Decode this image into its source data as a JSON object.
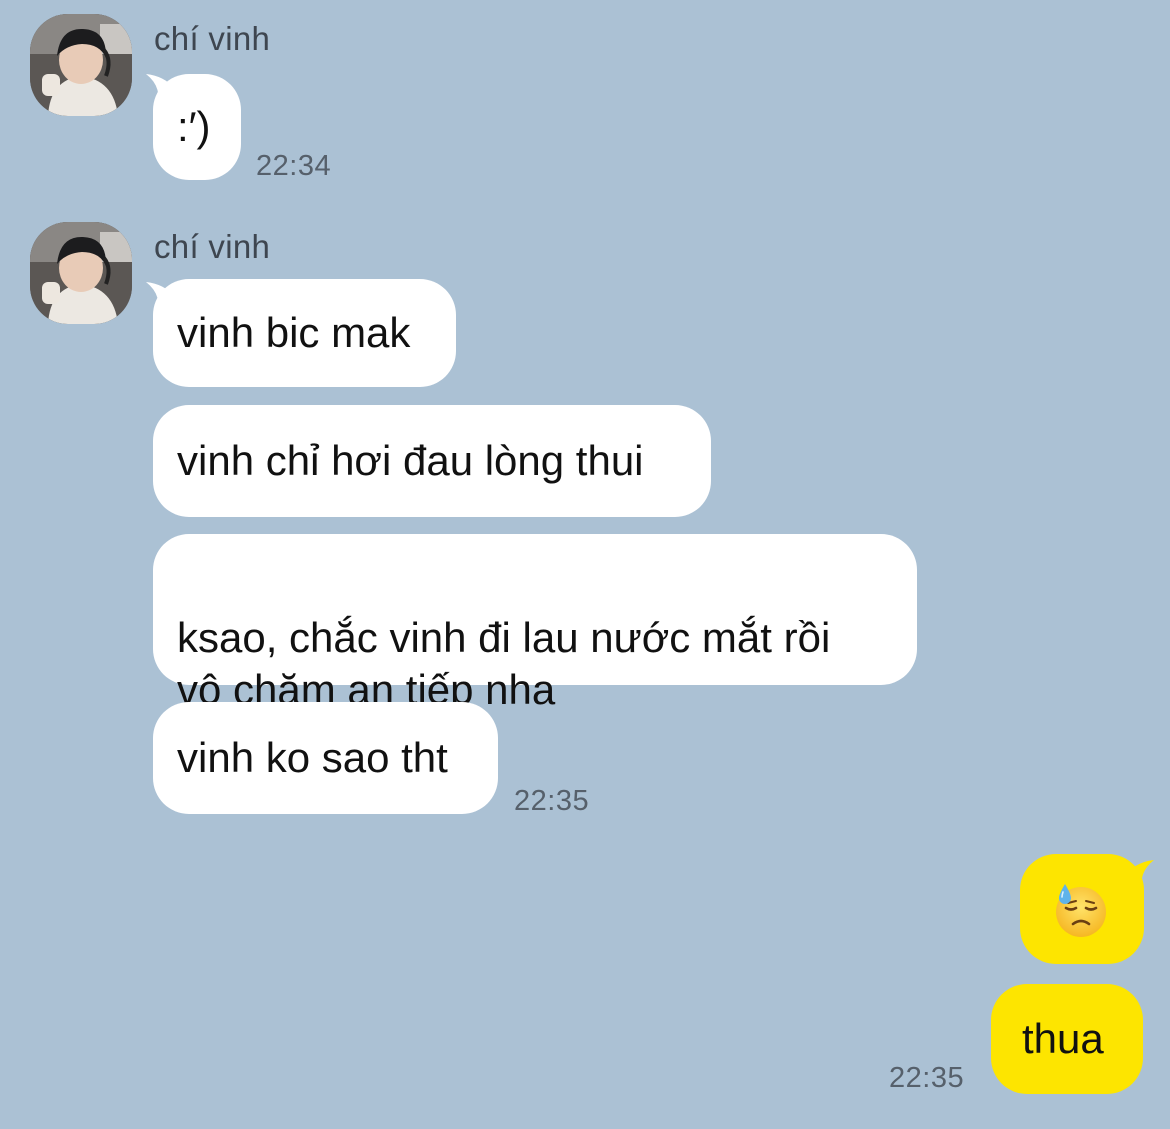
{
  "conversation": {
    "groups": [
      {
        "sender": "chí vinh",
        "messages": [
          ":′)"
        ],
        "time": "22:34"
      },
      {
        "sender": "chí vinh",
        "messages": [
          "vinh bic mak",
          "vinh chỉ hơi đau lòng thui",
          "ksao, chắc vinh đi lau nước mắt rồi\nvô chăm an tiếp nha",
          "vinh ko sao tht"
        ],
        "time": "22:35"
      }
    ],
    "my_messages": {
      "emoji": "downcast-face-with-sweat",
      "text": "thua",
      "time": "22:35"
    }
  },
  "colors": {
    "background": "#abc1d4",
    "their_bubble": "#ffffff",
    "my_bubble": "#fde500",
    "timestamp": "#56606b",
    "sender_name": "#3e4650"
  }
}
